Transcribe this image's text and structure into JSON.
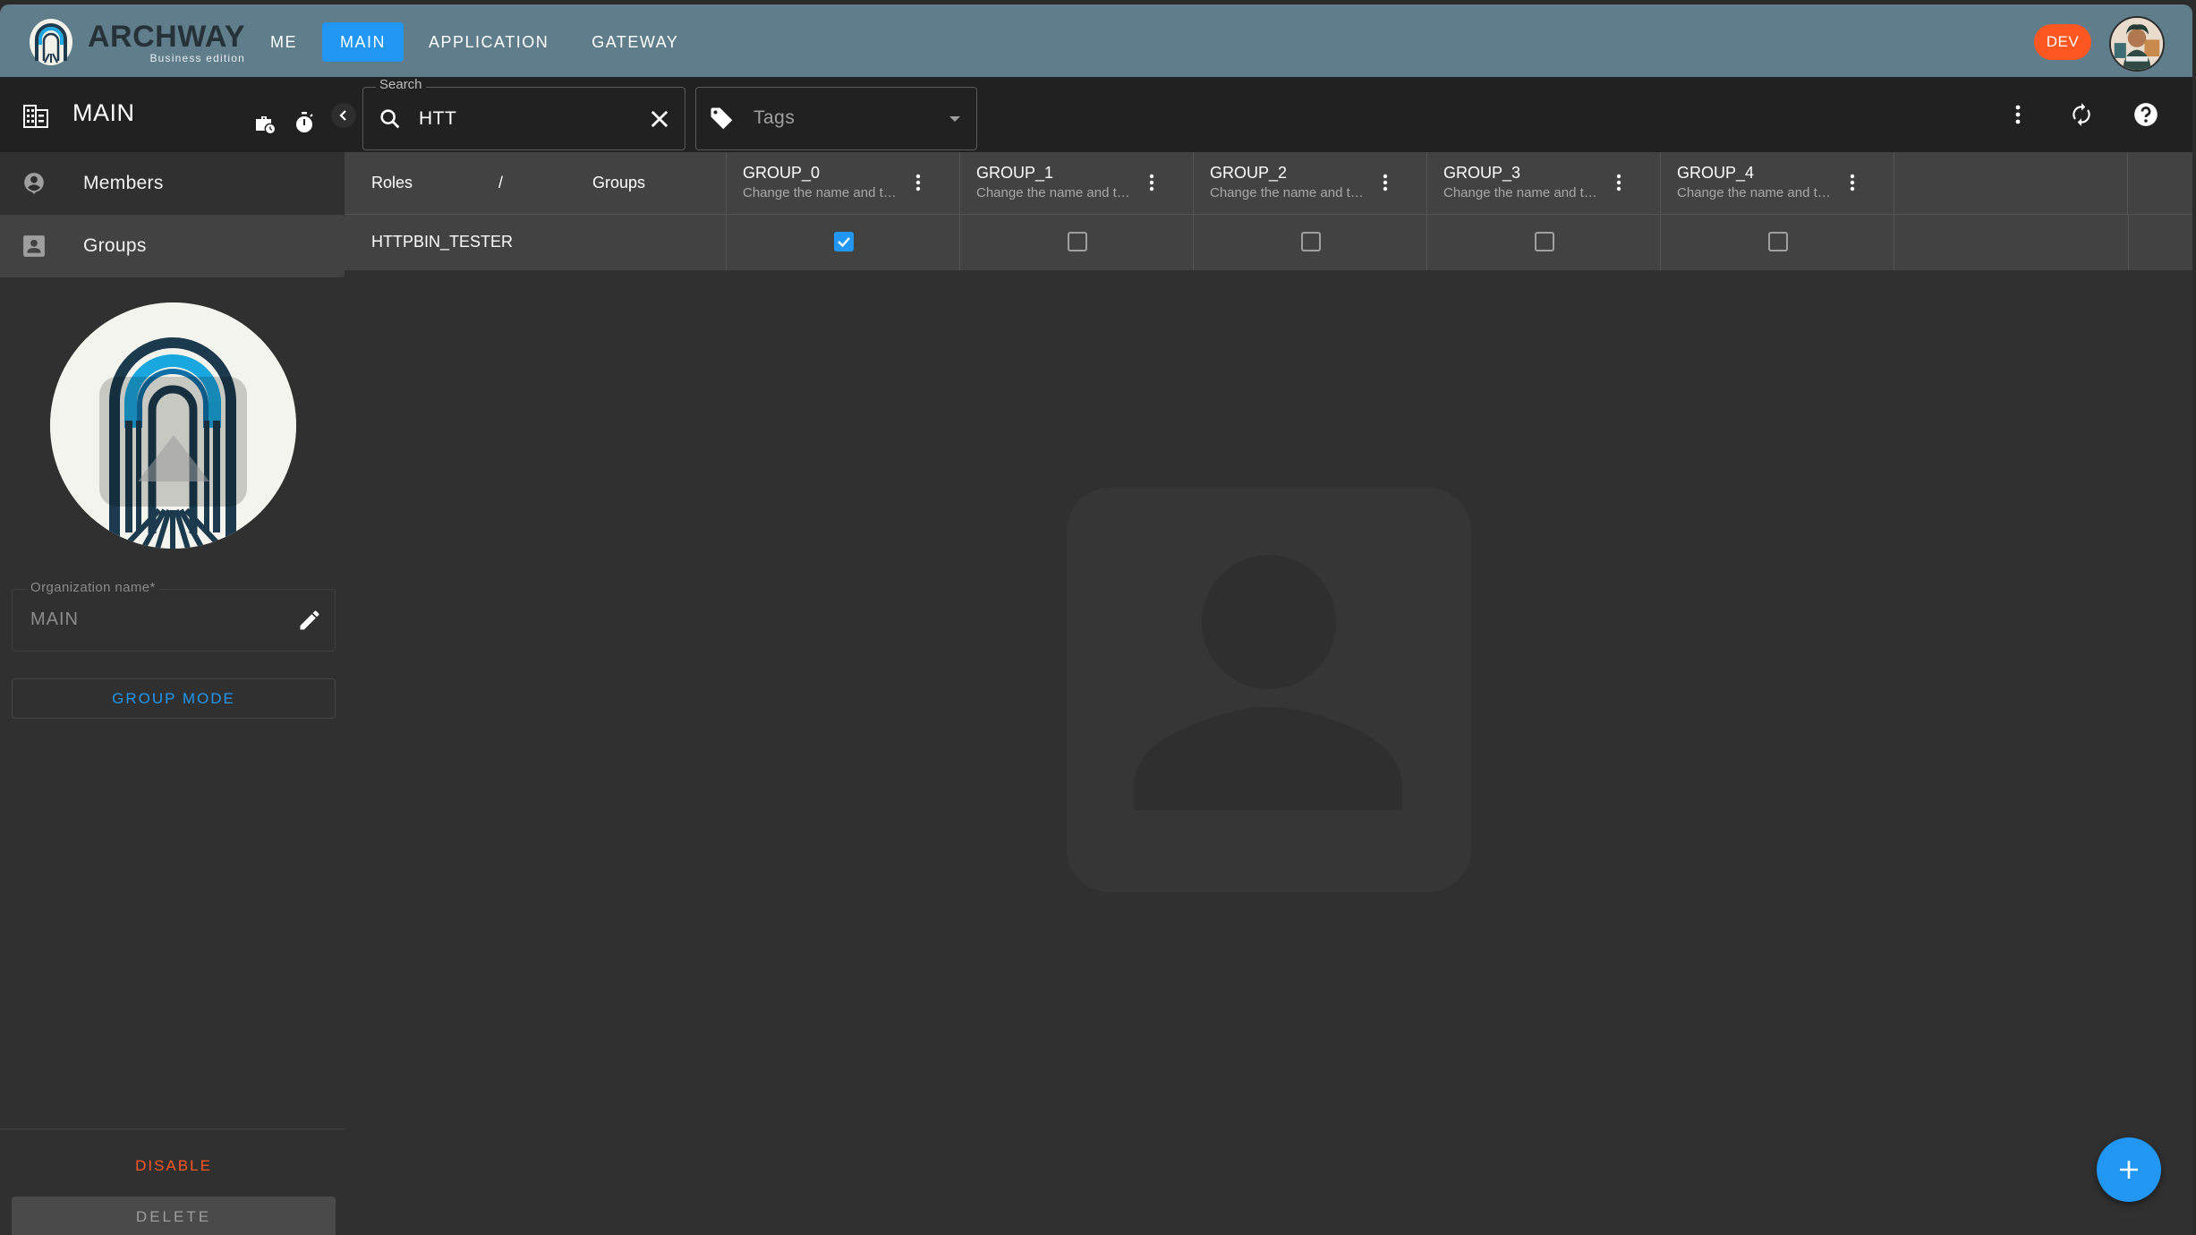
{
  "app": {
    "brand_name": "ARCHWAY",
    "brand_subtitle": "Business edition",
    "nav": [
      {
        "label": "ME",
        "active": false
      },
      {
        "label": "MAIN",
        "active": true
      },
      {
        "label": "APPLICATION",
        "active": false
      },
      {
        "label": "GATEWAY",
        "active": false
      }
    ],
    "env_badge": "DEV",
    "colors": {
      "appbar": "#607d8b",
      "accent": "#2196f3",
      "danger": "#ff5722"
    }
  },
  "sidebar": {
    "title": "MAIN",
    "items": [
      {
        "label": "Members",
        "icon": "account-circle-icon",
        "selected": false
      },
      {
        "label": "Groups",
        "icon": "account-box-icon",
        "selected": true
      }
    ],
    "org_field": {
      "label": "Organization name*",
      "value": "MAIN"
    },
    "group_mode_label": "GROUP MODE",
    "disable_label": "DISABLE",
    "delete_label": "DELETE"
  },
  "toolbar": {
    "search": {
      "label": "Search",
      "value": "HTT"
    },
    "tags": {
      "placeholder": "Tags"
    }
  },
  "grid": {
    "header": {
      "roles": "Roles",
      "separator": "/",
      "groups": "Groups"
    },
    "groups": [
      {
        "name": "GROUP_0",
        "description": "Change the name and t…"
      },
      {
        "name": "GROUP_1",
        "description": "Change the name and t…"
      },
      {
        "name": "GROUP_2",
        "description": "Change the name and t…"
      },
      {
        "name": "GROUP_3",
        "description": "Change the name and t…"
      },
      {
        "name": "GROUP_4",
        "description": "Change the name and t…"
      }
    ],
    "rows": [
      {
        "role": "HTTPBIN_TESTER",
        "checked": [
          true,
          false,
          false,
          false,
          false
        ]
      }
    ]
  }
}
